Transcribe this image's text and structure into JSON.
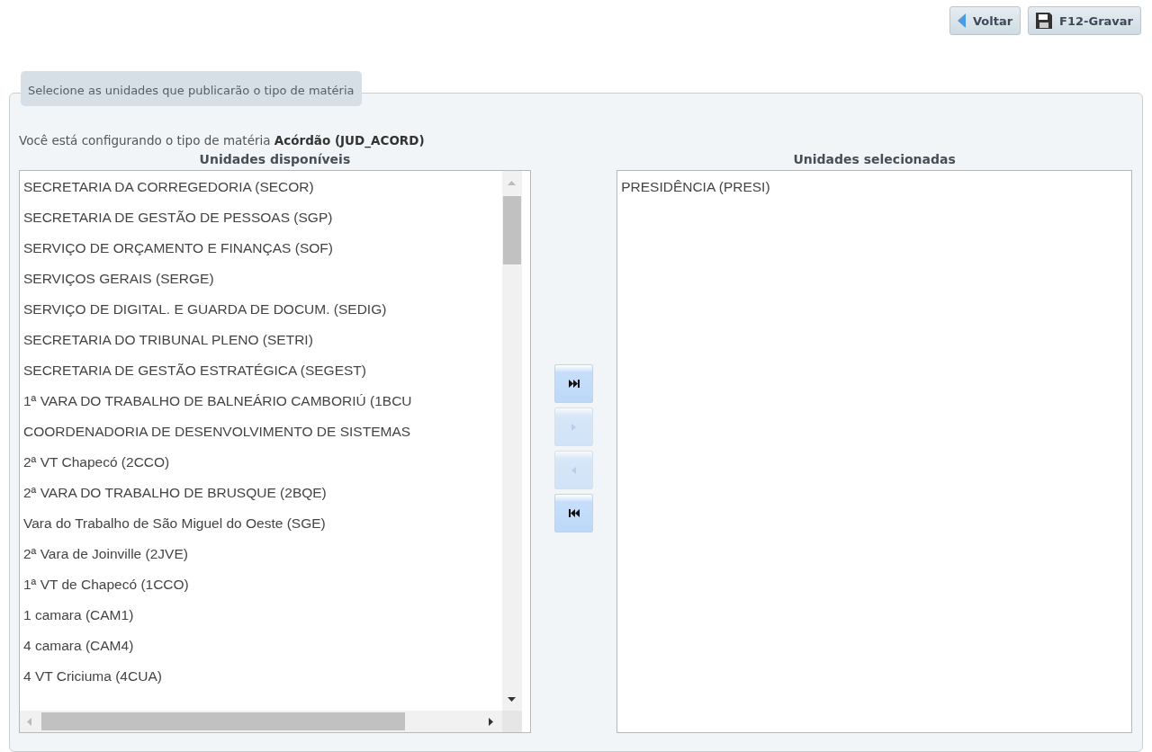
{
  "toolbar": [
    {
      "kind": "back",
      "label": "Voltar"
    },
    {
      "kind": "save",
      "label": "F12-Gravar"
    }
  ],
  "panel": {
    "legend": "Selecione as unidades que publicarão o tipo de matéria",
    "intro": "Você está configurando o tipo de matéria **Acórdão (JUD_ACORD)**"
  },
  "available": {
    "title": "Unidades disponíveis",
    "items": [
      "SECRETARIA DA CORREGEDORIA (SECOR)",
      "SECRETARIA DE GESTÃO DE PESSOAS (SGP)",
      "SERVIÇO DE ORÇAMENTO E FINANÇAS (SOF)",
      "SERVIÇOS GERAIS (SERGE)",
      "SERVIÇO DE DIGITAL. E GUARDA DE DOCUM. (SEDIG)",
      "SECRETARIA DO TRIBUNAL PLENO (SETRI)",
      "SECRETARIA DE GESTÃO ESTRATÉGICA (SEGEST)",
      "1ª VARA DO TRABALHO DE BALNEÁRIO CAMBORIÚ (1BCU",
      "COORDENADORIA DE DESENVOLVIMENTO DE SISTEMAS",
      "2ª VT Chapecó (2CCO)",
      "2ª VARA DO TRABALHO DE BRUSQUE (2BQE)",
      "Vara do Trabalho de São Miguel do Oeste (SGE)",
      "2ª Vara de Joinville (2JVE)",
      "1ª VT de Chapecó (1CCO)",
      "1 camara (CAM1)",
      "4 camara (CAM4)",
      "4 VT Criciuma (4CUA)"
    ]
  },
  "movers": [
    {
      "kind": "all-right",
      "disabled": false
    },
    {
      "kind": "right",
      "disabled": true
    },
    {
      "kind": "left",
      "disabled": true
    },
    {
      "kind": "all-left",
      "disabled": false
    }
  ],
  "selected": {
    "title": "Unidades selecionadas",
    "items": [
      "PRESIDÊNCIA (PRESI)"
    ]
  }
}
